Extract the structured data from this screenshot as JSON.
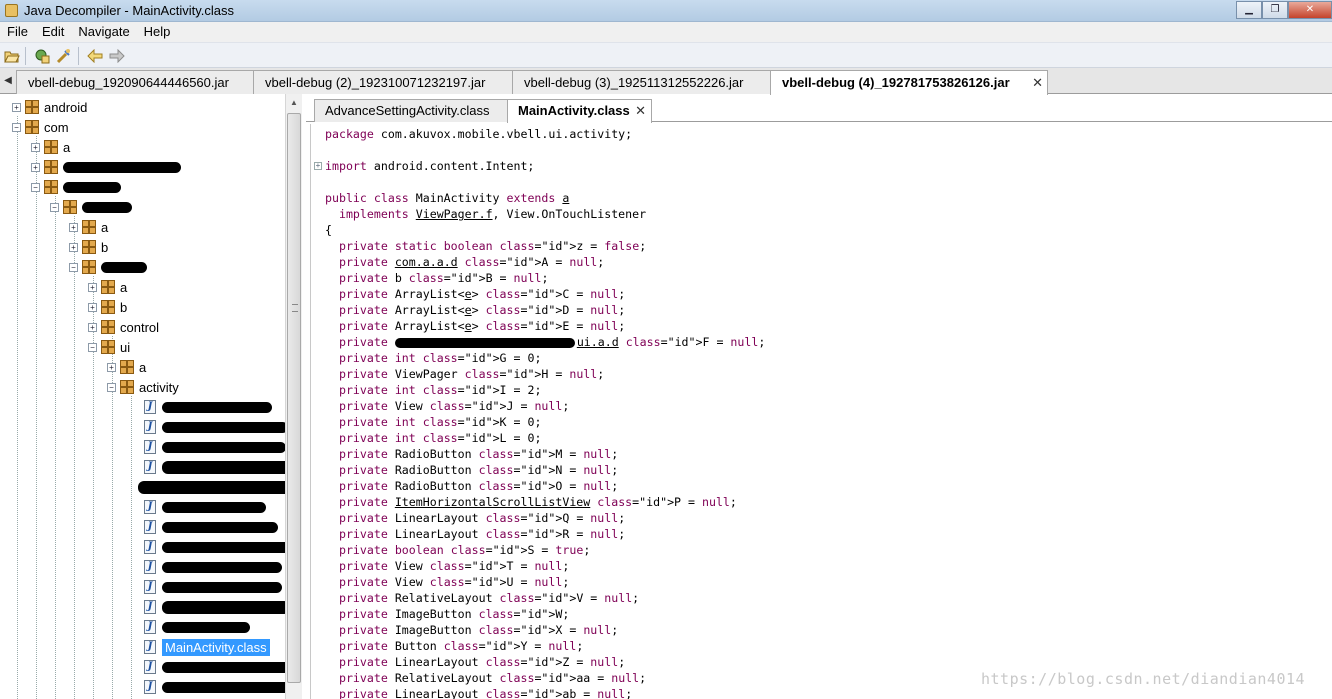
{
  "window": {
    "title": "Java Decompiler - MainActivity.class",
    "controls": [
      "minimize",
      "maximize",
      "close"
    ]
  },
  "menu": [
    "File",
    "Edit",
    "Navigate",
    "Help"
  ],
  "toolbar": {
    "icons": [
      "open-icon",
      "open-type-icon",
      "refresh-icon",
      "back-icon",
      "forward-icon"
    ]
  },
  "jar_tabs": [
    {
      "label": "vbell-debug_192090644446560.jar",
      "active": false
    },
    {
      "label": "vbell-debug (2)_192310071232197.jar",
      "active": false
    },
    {
      "label": "vbell-debug (3)_192511312552226.jar",
      "active": false
    },
    {
      "label": "vbell-debug (4)_192781753826126.jar",
      "active": true
    }
  ],
  "tree": {
    "items": [
      {
        "label": "android",
        "type": "package",
        "expanded": false
      },
      {
        "label": "com",
        "type": "package",
        "expanded": true
      },
      {
        "label": "a",
        "type": "package",
        "expanded": false
      },
      {
        "label": "",
        "type": "package",
        "redacted": true,
        "expanded": false
      },
      {
        "label": "",
        "type": "package",
        "redacted": true,
        "expanded": true
      },
      {
        "label": "",
        "type": "package",
        "redacted": true,
        "expanded": true
      },
      {
        "label": "a",
        "type": "package",
        "expanded": false
      },
      {
        "label": "b",
        "type": "package",
        "expanded": false
      },
      {
        "label": "",
        "type": "package",
        "redacted": true,
        "expanded": true
      },
      {
        "label": "a",
        "type": "package",
        "expanded": false
      },
      {
        "label": "b",
        "type": "package",
        "expanded": false
      },
      {
        "label": "control",
        "type": "package",
        "expanded": false
      },
      {
        "label": "ui",
        "type": "package",
        "expanded": true
      },
      {
        "label": "a",
        "type": "package",
        "expanded": false
      },
      {
        "label": "activity",
        "type": "package",
        "expanded": true
      },
      {
        "label": "",
        "type": "class",
        "redacted": true
      },
      {
        "label": "",
        "type": "class",
        "redacted": true
      },
      {
        "label": "",
        "type": "class",
        "redacted": true
      },
      {
        "label": "",
        "type": "class",
        "redacted": true
      },
      {
        "label": "",
        "type": "class",
        "redacted": true
      },
      {
        "label": "",
        "type": "class",
        "redacted": true
      },
      {
        "label": "",
        "type": "class",
        "redacted": true
      },
      {
        "label": "",
        "type": "class",
        "redacted": true
      },
      {
        "label": "",
        "type": "class",
        "redacted": true
      },
      {
        "label": "",
        "type": "class",
        "redacted": true
      },
      {
        "label": "",
        "type": "class",
        "redacted": true
      },
      {
        "label": "MainActivity.class",
        "type": "class",
        "selected": true
      },
      {
        "label": "",
        "type": "class",
        "redacted": true
      },
      {
        "label": "",
        "type": "class",
        "redacted": true
      }
    ]
  },
  "class_tabs": [
    {
      "label": "AdvanceSettingActivity.class",
      "active": false
    },
    {
      "label": "MainActivity.class",
      "active": true
    }
  ],
  "code_lines": [
    "package com.akuvox.mobile.vbell.ui.activity;",
    "",
    "import android.content.Intent;",
    "",
    "public class MainActivity extends a",
    "  implements ViewPager.f, View.OnTouchListener",
    "{",
    "  private static boolean z = false;",
    "  private com.a.a.d A = null;",
    "  private b B = null;",
    "  private ArrayList<e> C = null;",
    "  private ArrayList<e> D = null;",
    "  private ArrayList<e> E = null;",
    "  private ui.a.d F = null;",
    "  private int G = 0;",
    "  private ViewPager H = null;",
    "  private int I = 2;",
    "  private View J = null;",
    "  private int K = 0;",
    "  private int L = 0;",
    "  private RadioButton M = null;",
    "  private RadioButton N = null;",
    "  private RadioButton O = null;",
    "  private ItemHorizontalScrollListView P = null;",
    "  private LinearLayout Q = null;",
    "  private LinearLayout R = null;",
    "  private boolean S = true;",
    "  private View T = null;",
    "  private View U = null;",
    "  private RelativeLayout V = null;",
    "  private ImageButton W;",
    "  private ImageButton X = null;",
    "  private Button Y = null;",
    "  private LinearLayout Z = null;",
    "  private RelativeLayout aa = null;",
    "  private LinearLayout ab = null;"
  ],
  "watermark": "https://blog.csdn.net/diandian4014",
  "colors": {
    "keyword": "#7f0055",
    "field": "#0000c0",
    "selection": "#3399ff",
    "tab_bg": "#ececec"
  }
}
